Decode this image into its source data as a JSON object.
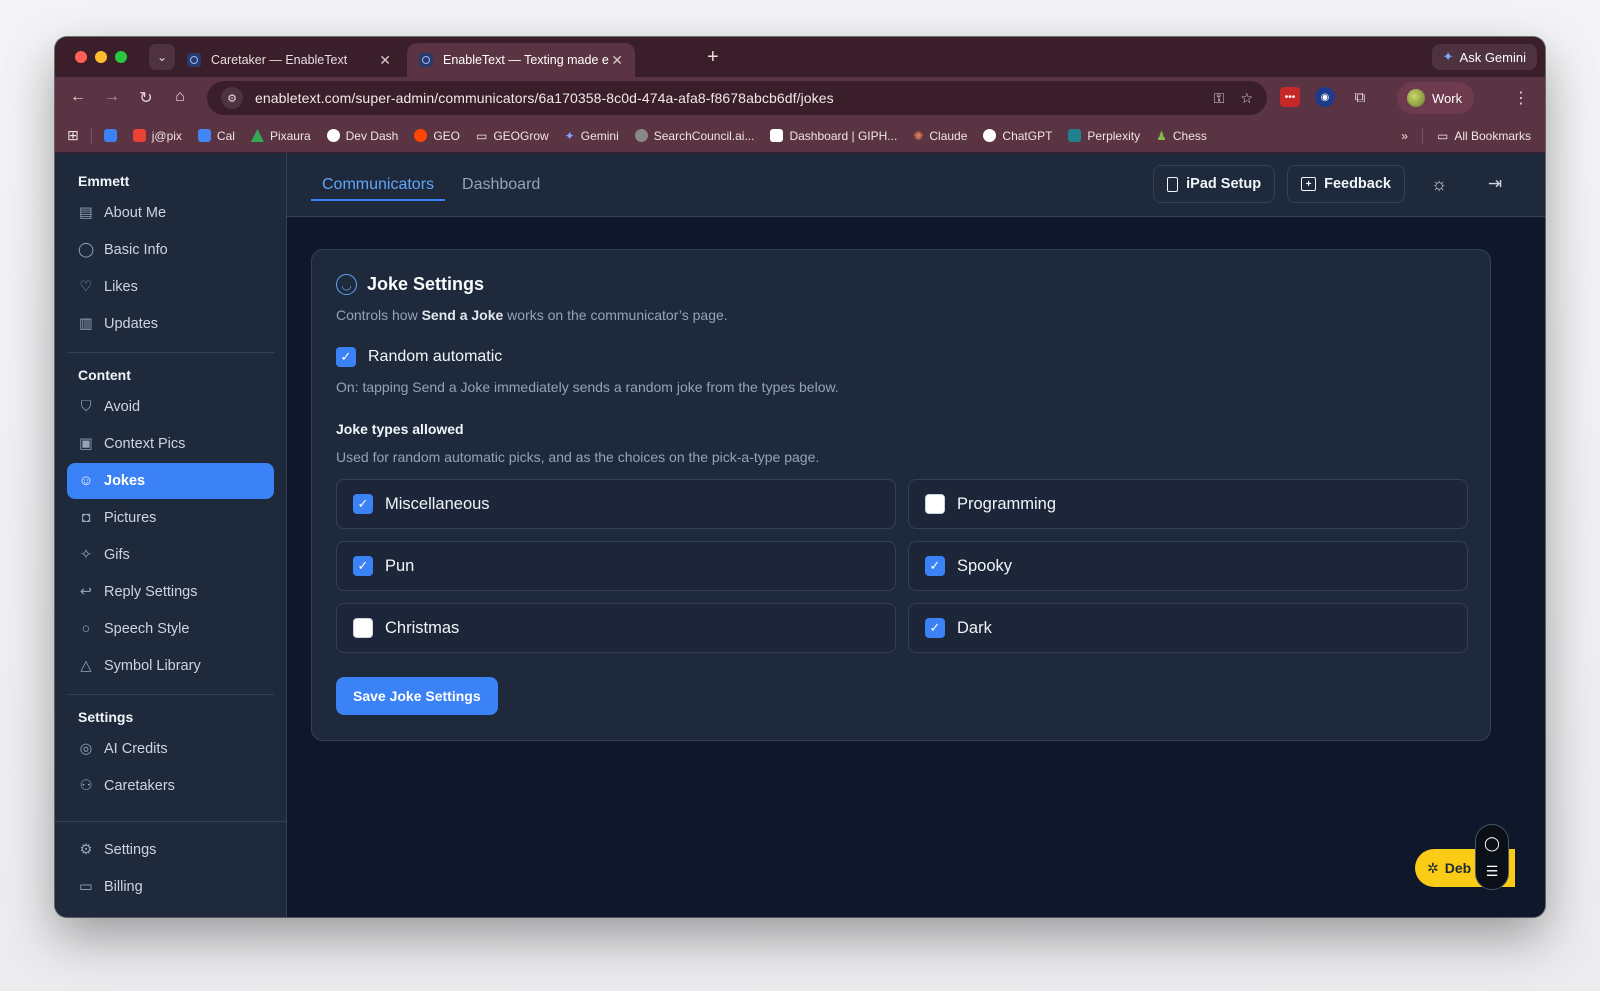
{
  "browser": {
    "tabs": [
      {
        "title": "Caretaker — EnableText",
        "active": false
      },
      {
        "title": "EnableText — Texting made e",
        "active": true
      }
    ],
    "ask_gemini": "Ask Gemini",
    "url": "enabletext.com/super-admin/communicators/6a170358-8c0d-474a-afa8-f8678abcb6df/jokes",
    "profile": "Work",
    "bookmarks": [
      {
        "label": "",
        "color": "#3b82f6"
      },
      {
        "label": "j@pix",
        "color": "#ea4335"
      },
      {
        "label": "Cal",
        "color": "#4285f4"
      },
      {
        "label": "Pixaura",
        "color": "#34a853"
      },
      {
        "label": "Dev Dash",
        "color": "#ffffff"
      },
      {
        "label": "GEO",
        "color": "#ff4500"
      },
      {
        "label": "GEOGrow",
        "color": "folder"
      },
      {
        "label": "Gemini",
        "color": "#7fa8ff"
      },
      {
        "label": "SearchCouncil.ai...",
        "color": "#888888"
      },
      {
        "label": "Dashboard | GIPH...",
        "color": "#ffffff"
      },
      {
        "label": "Claude",
        "color": "#d97757"
      },
      {
        "label": "ChatGPT",
        "color": "#ffffff"
      },
      {
        "label": "Perplexity",
        "color": "#20808d"
      },
      {
        "label": "Chess",
        "color": "#81b64c"
      }
    ],
    "all_bookmarks": "All Bookmarks"
  },
  "sidebar": {
    "user_name": "Emmett",
    "profile_items": [
      {
        "label": "About Me",
        "icon": "id-card-icon"
      },
      {
        "label": "Basic Info",
        "icon": "user-icon"
      },
      {
        "label": "Likes",
        "icon": "heart-icon"
      },
      {
        "label": "Updates",
        "icon": "newspaper-icon"
      }
    ],
    "content_heading": "Content",
    "content_items": [
      {
        "label": "Avoid",
        "icon": "shield-icon"
      },
      {
        "label": "Context Pics",
        "icon": "image-plus-icon"
      },
      {
        "label": "Jokes",
        "icon": "laugh-icon",
        "active": true
      },
      {
        "label": "Pictures",
        "icon": "camera-icon"
      },
      {
        "label": "Gifs",
        "icon": "sparkles-icon"
      },
      {
        "label": "Reply Settings",
        "icon": "reply-icon"
      },
      {
        "label": "Speech Style",
        "icon": "message-circle-icon"
      },
      {
        "label": "Symbol Library",
        "icon": "shapes-icon"
      }
    ],
    "settings_heading": "Settings",
    "settings_items": [
      {
        "label": "AI Credits",
        "icon": "coins-icon"
      },
      {
        "label": "Caretakers",
        "icon": "users-icon"
      }
    ],
    "footer_items": [
      {
        "label": "Settings",
        "icon": "gear-icon"
      },
      {
        "label": "Billing",
        "icon": "credit-card-icon"
      }
    ]
  },
  "topnav": {
    "tabs": [
      {
        "label": "Communicators",
        "active": true
      },
      {
        "label": "Dashboard",
        "active": false
      }
    ],
    "ipad_setup": "iPad Setup",
    "feedback": "Feedback"
  },
  "joke_settings": {
    "title": "Joke Settings",
    "desc_prefix": "Controls how ",
    "desc_bold": "Send a Joke",
    "desc_suffix": " works on the communicator’s page.",
    "random_label": "Random automatic",
    "random_checked": true,
    "random_help": "On: tapping Send a Joke immediately sends a random joke from the types below.",
    "types_heading": "Joke types allowed",
    "types_help": "Used for random automatic picks, and as the choices on the pick-a-type page.",
    "types": [
      {
        "label": "Miscellaneous",
        "checked": true
      },
      {
        "label": "Programming",
        "checked": false
      },
      {
        "label": "Pun",
        "checked": true
      },
      {
        "label": "Spooky",
        "checked": true
      },
      {
        "label": "Christmas",
        "checked": false
      },
      {
        "label": "Dark",
        "checked": true
      }
    ],
    "save_label": "Save Joke Settings"
  },
  "debug_label": "Deb",
  "colors": {
    "accent": "#3b82f6",
    "debug": "#facc15",
    "browser_frame": "#5a3443"
  }
}
